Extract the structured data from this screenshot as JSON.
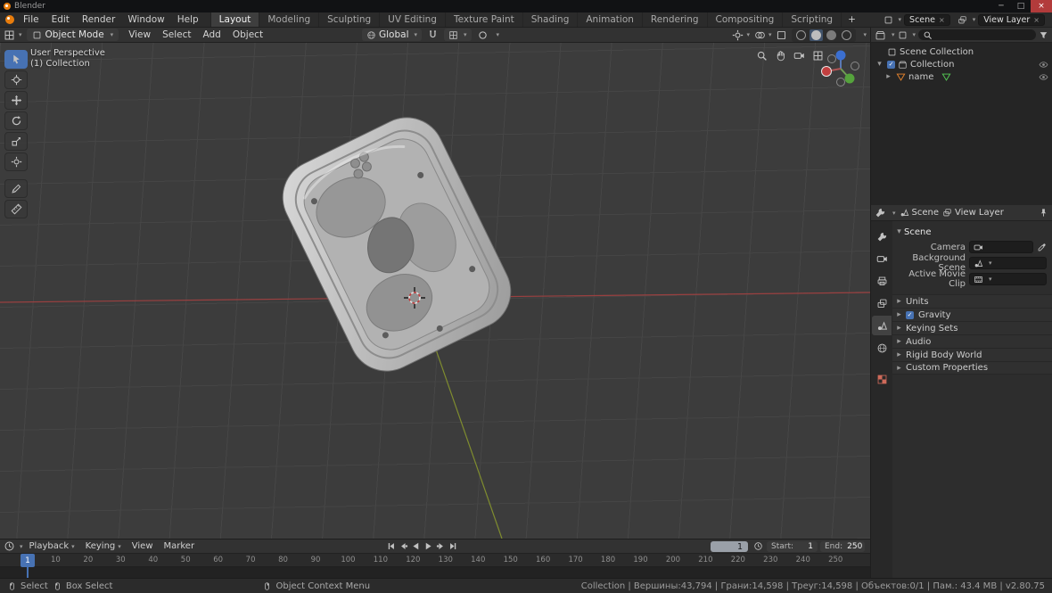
{
  "window": {
    "title": "Blender"
  },
  "topbar": {
    "menus": [
      "File",
      "Edit",
      "Render",
      "Window",
      "Help"
    ],
    "workspaces": [
      "Layout",
      "Modeling",
      "Sculpting",
      "UV Editing",
      "Texture Paint",
      "Shading",
      "Animation",
      "Rendering",
      "Compositing",
      "Scripting"
    ],
    "add_tab": "+",
    "scene": "Scene",
    "view_layer": "View Layer"
  },
  "viewport_header": {
    "mode": "Object Mode",
    "menus": [
      "View",
      "Select",
      "Add",
      "Object"
    ],
    "orientation": "Global"
  },
  "viewport": {
    "perspective_label": "User Perspective",
    "collection_label": "(1) Collection"
  },
  "outliner": {
    "scene_collection": "Scene Collection",
    "collection": "Collection",
    "object": "name"
  },
  "properties": {
    "path_scene": "Scene",
    "path_view_layer": "View Layer",
    "scene_section": "Scene",
    "camera_label": "Camera",
    "background_scene_label": "Background Scene",
    "active_movie_clip_label": "Active Movie Clip",
    "sections": [
      "Units",
      "Gravity",
      "Keying Sets",
      "Audio",
      "Rigid Body World",
      "Custom Properties"
    ]
  },
  "timeline": {
    "menus": [
      "Playback",
      "Keying",
      "View",
      "Marker"
    ],
    "current_frame": "1",
    "start_label": "Start:",
    "start_value": "1",
    "end_label": "End:",
    "end_value": "250",
    "ticks": [
      "1",
      "10",
      "20",
      "30",
      "40",
      "50",
      "60",
      "70",
      "80",
      "90",
      "100",
      "110",
      "120",
      "130",
      "140",
      "150",
      "160",
      "170",
      "180",
      "190",
      "200",
      "210",
      "220",
      "230",
      "240",
      "250"
    ]
  },
  "statusbar": {
    "select": "Select",
    "box_select": "Box Select",
    "context_menu": "Object Context Menu",
    "stats": "Collection | Вершины:43,794 | Грани:14,598 | Треуг:14,598 | Объектов:0/1 | Пам.: 43.4 MB | v2.80.75"
  }
}
